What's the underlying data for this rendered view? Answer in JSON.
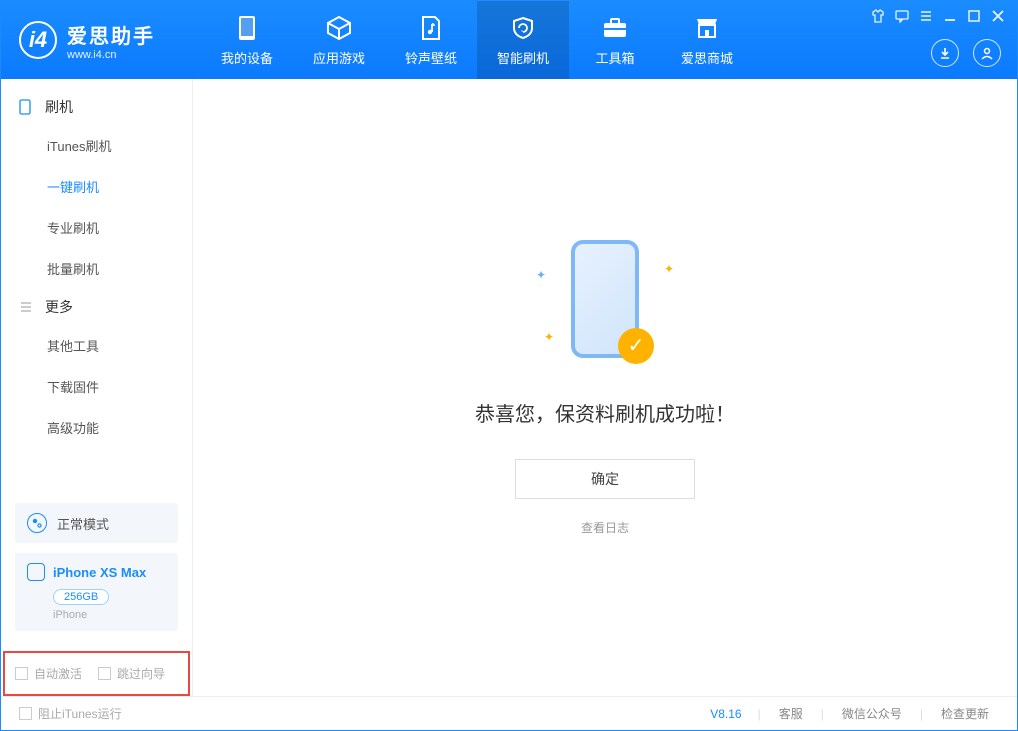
{
  "app": {
    "title": "爱思助手",
    "subtitle": "www.i4.cn"
  },
  "nav": {
    "tabs": [
      {
        "label": "我的设备"
      },
      {
        "label": "应用游戏"
      },
      {
        "label": "铃声壁纸"
      },
      {
        "label": "智能刷机"
      },
      {
        "label": "工具箱"
      },
      {
        "label": "爱思商城"
      }
    ]
  },
  "sidebar": {
    "section1": {
      "title": "刷机",
      "items": [
        {
          "label": "iTunes刷机"
        },
        {
          "label": "一键刷机"
        },
        {
          "label": "专业刷机"
        },
        {
          "label": "批量刷机"
        }
      ]
    },
    "section2": {
      "title": "更多",
      "items": [
        {
          "label": "其他工具"
        },
        {
          "label": "下载固件"
        },
        {
          "label": "高级功能"
        }
      ]
    },
    "mode": "正常模式",
    "device": {
      "name": "iPhone XS Max",
      "storage": "256GB",
      "type": "iPhone"
    },
    "checkboxes": {
      "auto_activate": "自动激活",
      "skip_guide": "跳过向导"
    }
  },
  "main": {
    "success_title": "恭喜您，保资料刷机成功啦！",
    "ok_button": "确定",
    "view_log": "查看日志"
  },
  "footer": {
    "block_itunes": "阻止iTunes运行",
    "version": "V8.16",
    "links": {
      "support": "客服",
      "wechat": "微信公众号",
      "update": "检查更新"
    }
  }
}
